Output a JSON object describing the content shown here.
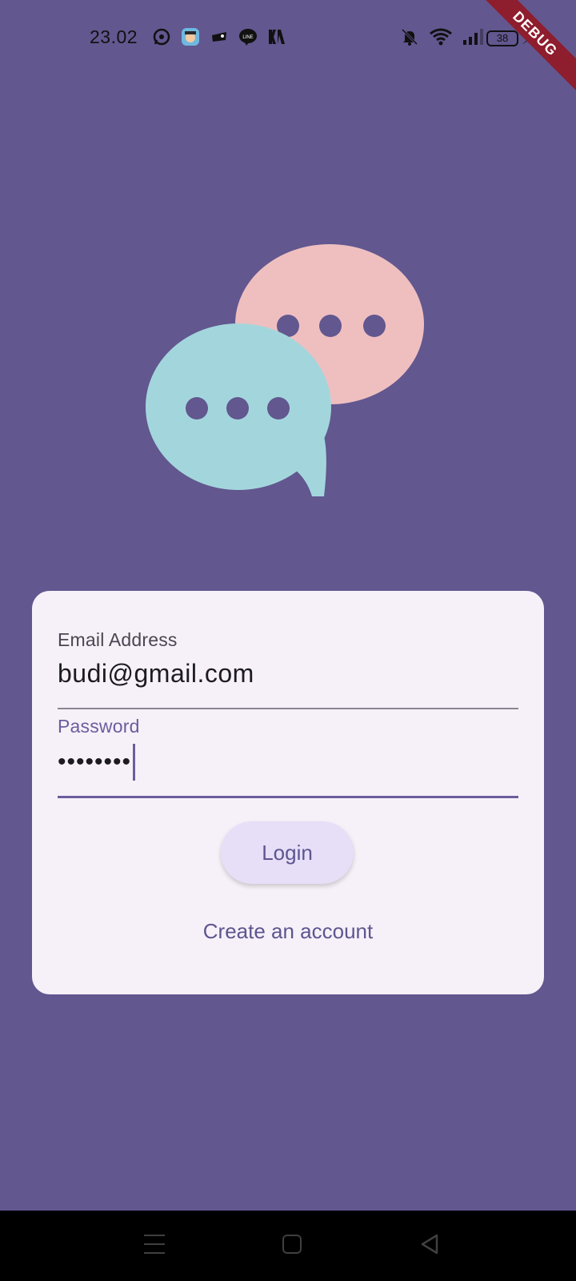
{
  "status_bar": {
    "time": "23.02",
    "notification_icons": [
      "whatsapp-icon",
      "avatar-app-icon",
      "game-controller-icon",
      "line-icon",
      "kai-icon"
    ],
    "system_icons": [
      "bell-muted-icon",
      "wifi-icon",
      "signal-icon",
      "battery-icon"
    ],
    "battery_level": "38"
  },
  "debug_banner": "DEBUG",
  "login_form": {
    "email": {
      "label": "Email Address",
      "value": "budi@gmail.com"
    },
    "password": {
      "label": "Password",
      "value": "••••••••"
    },
    "login_label": "Login",
    "create_account_label": "Create an account"
  },
  "colors": {
    "background": "#62578F",
    "card": "#F6F1F8",
    "accent": "#6A5D9E",
    "button": "#E7DEF8",
    "bubble_pink": "#EFBFC0",
    "bubble_teal": "#A3D6DC"
  },
  "navigation_bar": {
    "icons": [
      "menu-icon",
      "home-icon",
      "back-icon"
    ]
  }
}
